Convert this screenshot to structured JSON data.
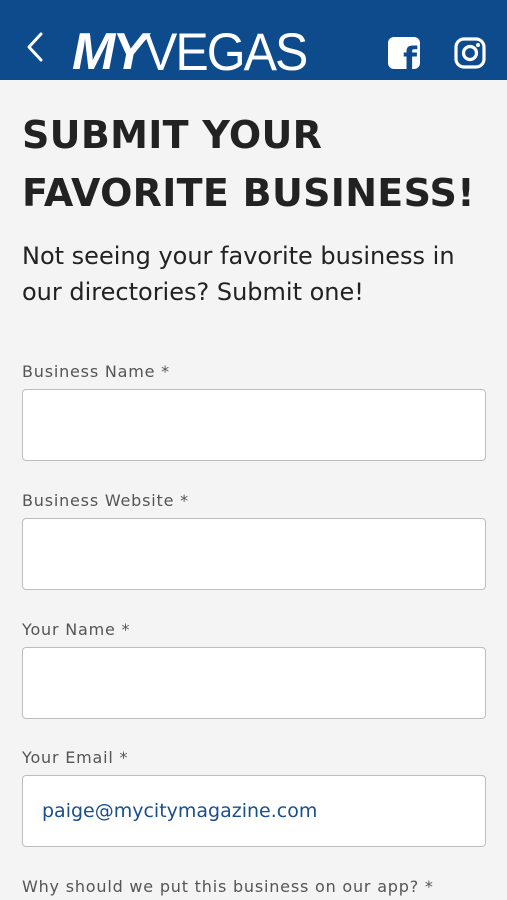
{
  "header": {
    "logo_my": "MY",
    "logo_vegas": "VEGAS",
    "facebook_glyph": "f",
    "back_icon": "chevron-left-icon",
    "colors": {
      "bar": "#0e4b8c",
      "text": "#ffffff"
    }
  },
  "page": {
    "title_line1": "SUBMIT YOUR",
    "title_line2": "FAVORITE BUSINESS!",
    "subtitle": "Not seeing your favorite business in our directories? Submit one!"
  },
  "form": {
    "fields": [
      {
        "label": "Business Name *",
        "value": ""
      },
      {
        "label": "Business Website *",
        "value": ""
      },
      {
        "label": "Your Name *",
        "value": ""
      },
      {
        "label": "Your Email *",
        "value": "paige@mycitymagazine.com"
      },
      {
        "label": "Why should we put this business on our app?  *",
        "value": ""
      }
    ]
  }
}
